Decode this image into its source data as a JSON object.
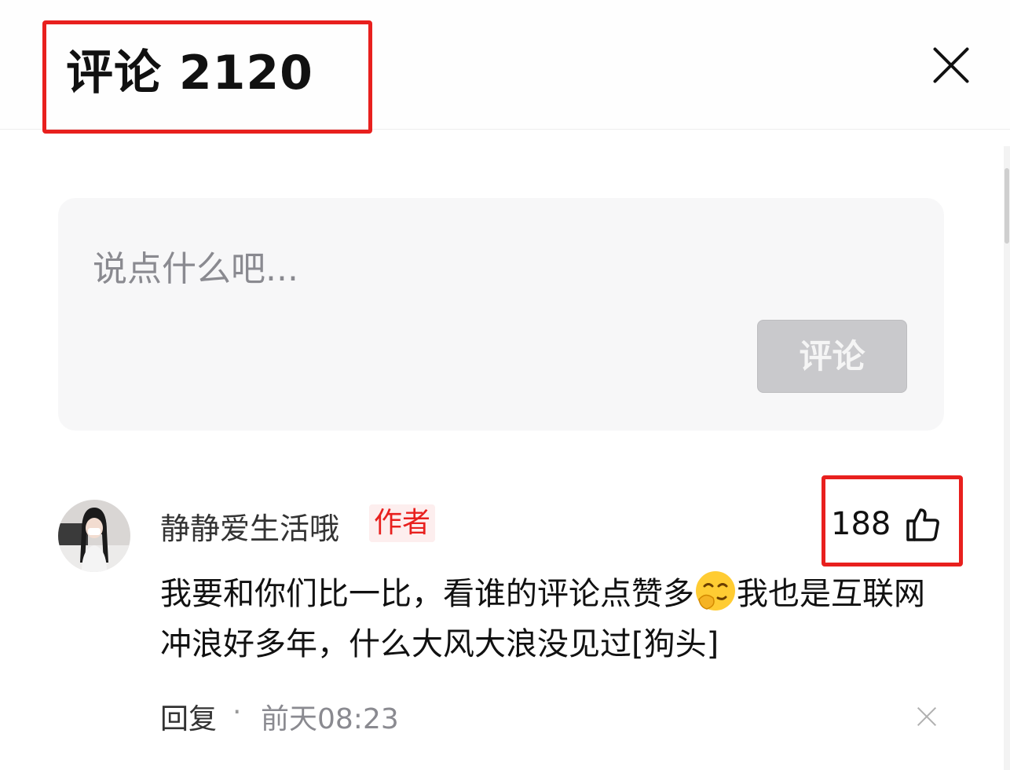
{
  "header": {
    "title": "评论 2120"
  },
  "input": {
    "placeholder": "说点什么吧...",
    "submit_label": "评论"
  },
  "comment": {
    "username": "静静爱生活哦",
    "author_badge": "作者",
    "likes": "188",
    "text_part1": "我要和你们比一比，看谁的评论点赞多",
    "emoji": "smirk-emoji",
    "text_part2": "我也是互联网冲浪好多年，什么大风大浪没见过[狗头]",
    "reply_label": "回复",
    "separator": "·",
    "timestamp": "前天08:23"
  },
  "colors": {
    "highlight_border": "#e8201e",
    "author_badge": "#e8201e",
    "submit_button_bg": "#c9c9cc",
    "input_bg": "#f7f7f8"
  }
}
